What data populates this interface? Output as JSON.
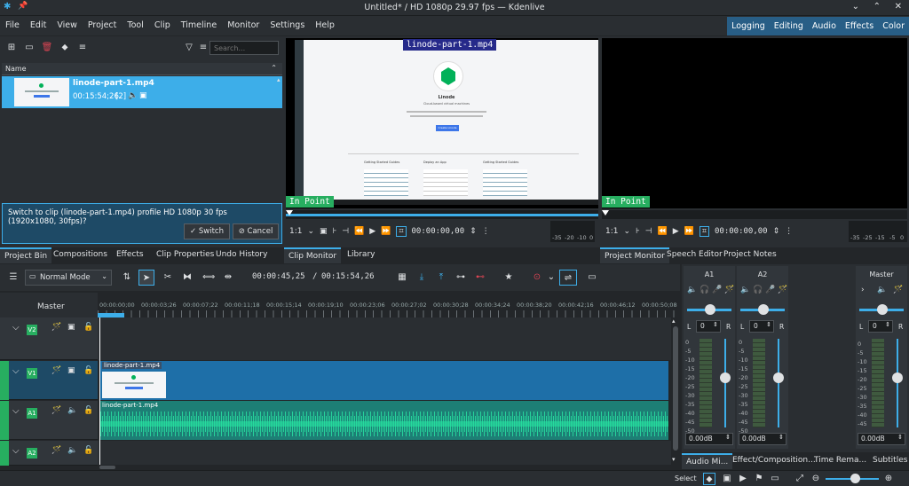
{
  "window": {
    "title": "Untitled* / HD 1080p 29.97 fps — Kdenlive"
  },
  "menu": [
    "File",
    "Edit",
    "View",
    "Project",
    "Tool",
    "Clip",
    "Timeline",
    "Monitor",
    "Settings",
    "Help"
  ],
  "layouts": [
    "Logging",
    "Editing",
    "Audio",
    "Effects",
    "Color"
  ],
  "bin": {
    "search_placeholder": "Search...",
    "column": "Name",
    "clip": {
      "name": "linode-part-1.mp4",
      "duration": "00:15:54;26",
      "count": "[2]"
    },
    "message": "Switch to clip (linode-part-1.mp4) profile HD 1080p 30 fps (1920x1080, 30fps)?",
    "switch_label": "Switch",
    "cancel_label": "Cancel",
    "tabs": [
      "Project Bin",
      "Compositions",
      "Effects",
      "Clip Properties",
      "Undo History"
    ]
  },
  "clip_monitor": {
    "overlay_title": "linode-part-1.mp4",
    "in_point": "In Point",
    "zoom": "1:1",
    "timecode": "00:00:00,00",
    "meter_labels": [
      "-35",
      "-20",
      "-10",
      "0"
    ],
    "tabs": [
      "Clip Monitor",
      "Library"
    ],
    "preview": {
      "heading": "Linode",
      "sub": "Cloud-based virtual machines",
      "button": "Create Linode",
      "sections": [
        "Getting Started Guides",
        "Deploy an App",
        "Getting Started Guides"
      ]
    }
  },
  "project_monitor": {
    "in_point": "In Point",
    "zoom": "1:1",
    "timecode": "00:00:00,00",
    "meter_labels": [
      "-35",
      "-25",
      "-15",
      "-5",
      "0"
    ],
    "tabs": [
      "Project Monitor",
      "Speech Editor",
      "Project Notes"
    ]
  },
  "timeline": {
    "mode": "Normal Mode",
    "position": "00:00:45,25",
    "duration": "00:15:54,26",
    "master": "Master",
    "ruler": [
      "00:00:00;00",
      "00:00:03;26",
      "00:00:07;22",
      "00:00:11;18",
      "00:00:15;14",
      "00:00:19;10",
      "00:00:23;06",
      "00:00:27;02",
      "00:00:30;28",
      "00:00:34;24",
      "00:00:38;20",
      "00:00:42;16",
      "00:00:46;12",
      "00:00:50;08"
    ],
    "tracks": [
      {
        "label": "V2"
      },
      {
        "label": "V1",
        "clip": "linode-part-1.mp4"
      },
      {
        "label": "A1",
        "clip": "linode-part-1.mp4"
      },
      {
        "label": "A2"
      }
    ]
  },
  "mixer": {
    "channels": [
      {
        "name": "A1",
        "pan": "0",
        "level": "0.00dB"
      },
      {
        "name": "A2",
        "pan": "0",
        "level": "0.00dB"
      },
      {
        "name": "Master",
        "pan": "0",
        "level": "0.00dB"
      }
    ],
    "scale": [
      "0",
      "-5",
      "-10",
      "-15",
      "-20",
      "-25",
      "-30",
      "-35",
      "-40",
      "-45",
      "-50"
    ],
    "lr": [
      "L",
      "R"
    ],
    "tabs": [
      "Audio Mi...",
      "Effect/Composition...",
      "Time Rema...",
      "Subtitles"
    ]
  },
  "statusbar": {
    "tool": "Select"
  },
  "colors": {
    "accent": "#3daee9",
    "selection": "#2980b9",
    "track_label": "#27ae60",
    "video_clip": "#1e6fa8",
    "audio_clip": "#1d7f75",
    "layout_bar": "#285e86"
  }
}
